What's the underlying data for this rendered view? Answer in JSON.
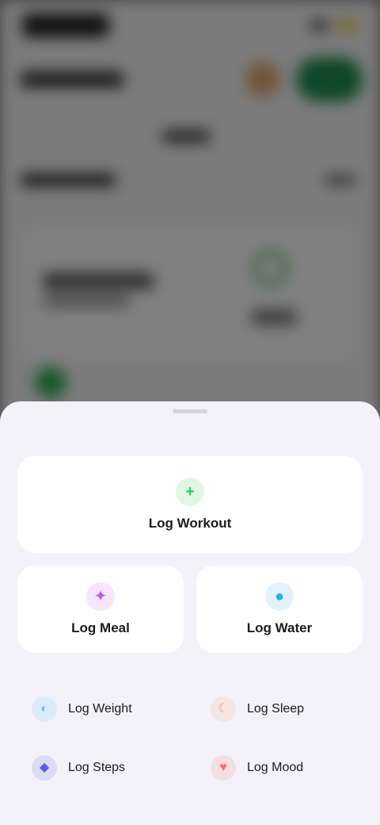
{
  "sheet": {
    "primary": {
      "label": "Log Workout",
      "icon": "plus-icon",
      "color": "#34c759"
    },
    "secondary": [
      {
        "label": "Log Meal",
        "icon": "fork-knife-icon",
        "color": "#bf5af2"
      },
      {
        "label": "Log Water",
        "icon": "water-drop-icon",
        "color": "#32ade6"
      }
    ],
    "list": [
      {
        "label": "Log Weight",
        "icon": "scale-icon",
        "color": "#5ac8fa"
      },
      {
        "label": "Log Sleep",
        "icon": "moon-icon",
        "color": "#ff9f6b"
      },
      {
        "label": "Log Steps",
        "icon": "footsteps-icon",
        "color": "#5e5ce6"
      },
      {
        "label": "Log Mood",
        "icon": "heart-icon",
        "color": "#ff6b6b"
      }
    ]
  },
  "icons": {
    "plus": "+",
    "fork": "✦",
    "drop": "●",
    "scale": "◐",
    "moon": "☾",
    "steps": "◆",
    "heart": "♥"
  }
}
